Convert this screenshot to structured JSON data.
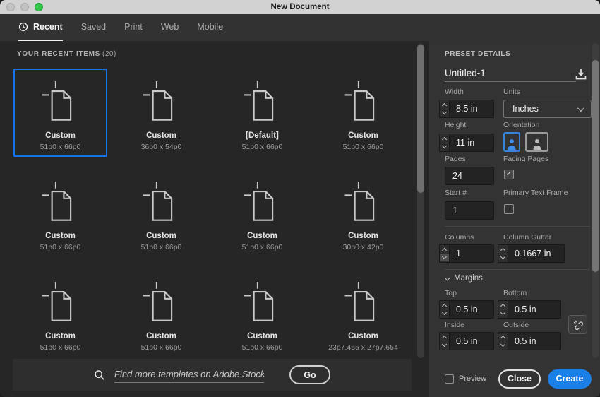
{
  "window": {
    "title": "New Document"
  },
  "tabs": [
    {
      "label": "Recent",
      "active": true
    },
    {
      "label": "Saved",
      "active": false
    },
    {
      "label": "Print",
      "active": false
    },
    {
      "label": "Web",
      "active": false
    },
    {
      "label": "Mobile",
      "active": false
    }
  ],
  "recent": {
    "heading": "YOUR RECENT ITEMS",
    "count": "(20)",
    "items": [
      {
        "name": "Custom",
        "dims": "51p0 x 66p0",
        "selected": true
      },
      {
        "name": "Custom",
        "dims": "36p0 x 54p0",
        "selected": false
      },
      {
        "name": "[Default]",
        "dims": "51p0 x 66p0",
        "selected": false
      },
      {
        "name": "Custom",
        "dims": "51p0 x 66p0",
        "selected": false
      },
      {
        "name": "Custom",
        "dims": "51p0 x 66p0",
        "selected": false
      },
      {
        "name": "Custom",
        "dims": "51p0 x 66p0",
        "selected": false
      },
      {
        "name": "Custom",
        "dims": "51p0 x 66p0",
        "selected": false
      },
      {
        "name": "Custom",
        "dims": "30p0 x 42p0",
        "selected": false
      },
      {
        "name": "Custom",
        "dims": "51p0 x 66p0",
        "selected": false
      },
      {
        "name": "Custom",
        "dims": "51p0 x 66p0",
        "selected": false
      },
      {
        "name": "Custom",
        "dims": "51p0 x 66p0",
        "selected": false
      },
      {
        "name": "Custom",
        "dims": "23p7.465 x 27p7.654",
        "selected": false
      }
    ]
  },
  "search": {
    "placeholder": "Find more templates on Adobe Stock",
    "go_label": "Go"
  },
  "preset": {
    "heading": "PRESET DETAILS",
    "name_value": "Untitled-1",
    "width": {
      "label": "Width",
      "value": "8.5 in"
    },
    "units": {
      "label": "Units",
      "value": "Inches"
    },
    "height": {
      "label": "Height",
      "value": "11 in"
    },
    "orientation": {
      "label": "Orientation",
      "selected": "portrait"
    },
    "pages": {
      "label": "Pages",
      "value": "24"
    },
    "facing_pages": {
      "label": "Facing Pages",
      "checked": true
    },
    "start_number": {
      "label": "Start #",
      "value": "1"
    },
    "primary_text_frame": {
      "label": "Primary Text Frame",
      "checked": false
    },
    "columns": {
      "label": "Columns",
      "value": "1"
    },
    "column_gutter": {
      "label": "Column Gutter",
      "value": "0.1667 in"
    },
    "margins": {
      "section_label": "Margins",
      "top": {
        "label": "Top",
        "value": "0.5 in"
      },
      "bottom": {
        "label": "Bottom",
        "value": "0.5 in"
      },
      "inside": {
        "label": "Inside",
        "value": "0.5 in"
      },
      "outside": {
        "label": "Outside",
        "value": "0.5 in"
      }
    }
  },
  "actions": {
    "preview_label": "Preview",
    "close_label": "Close",
    "create_label": "Create"
  },
  "colors": {
    "accent": "#1473e6",
    "create_button": "#1b7fe8",
    "selection_border": "#1473e6",
    "titlebar": "#d2d2d2",
    "traffic_green": "#34c749",
    "panel_bg": "#333333",
    "content_bg": "#262626"
  }
}
